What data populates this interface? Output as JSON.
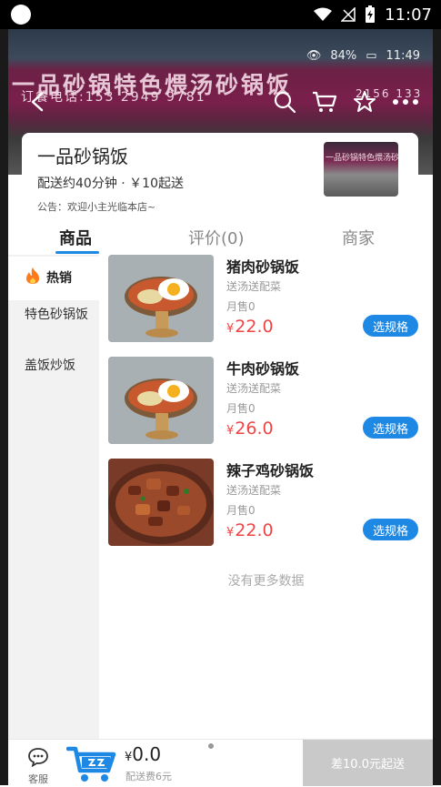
{
  "status_bar": {
    "time": "11:07"
  },
  "hero": {
    "inner_status": {
      "battery": "84%",
      "time": "11:49"
    },
    "sign_text": "一品砂锅特色煨汤砂锅饭",
    "phone_left": "订餐电话:153 2949 9781",
    "phone_right": "2156 133"
  },
  "shop": {
    "name": "一品砂锅饭",
    "meta": "配送约40分钟 · ￥10起送",
    "notice": "公告：欢迎小主光临本店~",
    "thumb_sign": "一品砂锅特色煨汤砂锅饭"
  },
  "tabs": [
    {
      "label": "商品",
      "active": true
    },
    {
      "label": "评价(0)",
      "active": false
    },
    {
      "label": "商家",
      "active": false
    }
  ],
  "categories": [
    {
      "label": "热销",
      "active": true,
      "icon": "fire-icon"
    },
    {
      "label": "特色砂锅饭",
      "active": false
    },
    {
      "label": "盖饭炒饭",
      "active": false
    }
  ],
  "products": [
    {
      "name": "猪肉砂锅饭",
      "desc": "送汤送配菜",
      "sold": "月售0",
      "currency": "¥",
      "price": "22.0",
      "button": "选规格"
    },
    {
      "name": "牛肉砂锅饭",
      "desc": "送汤送配菜",
      "sold": "月售0",
      "currency": "¥",
      "price": "26.0",
      "button": "选规格"
    },
    {
      "name": "辣子鸡砂锅饭",
      "desc": "送汤送配菜",
      "sold": "月售0",
      "currency": "¥",
      "price": "22.0",
      "button": "选规格"
    }
  ],
  "no_more": "没有更多数据",
  "bottom_bar": {
    "service_label": "客服",
    "currency": "¥",
    "total": "0.0",
    "delivery_fee": "配送费6元",
    "checkout": "差10.0元起送"
  },
  "colors": {
    "accent": "#1e88e5",
    "price": "#f04545",
    "checkout_disabled": "#c9c9c9"
  }
}
